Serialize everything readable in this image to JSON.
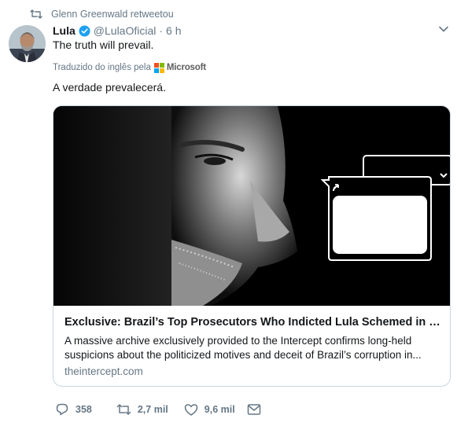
{
  "retweet": {
    "text": "Glenn Greenwald retweetou"
  },
  "tweet": {
    "display_name": "Lula",
    "handle": "@LulaOficial",
    "separator": "·",
    "time": "6 h",
    "text": "The truth will prevail.",
    "translation_label": "Traduzido do inglês pela",
    "translation_provider": "Microsoft",
    "translated_text": "A verdade prevalecerá."
  },
  "card": {
    "title": "Exclusive: Brazil’s Top Prosecutors Who Indicted Lula Schemed in S...",
    "description_line1": "A massive archive exclusively provided to the Intercept confirms long-held",
    "description_line2": "suspicions about the politicized motives and deceit of Brazil’s corruption in...",
    "domain": "theintercept.com"
  },
  "actions": {
    "replies": "358",
    "retweets": "2,7 mil",
    "likes": "9,6 mil"
  },
  "colors": {
    "muted": "#657786",
    "verified": "#1da1f2",
    "border": "#ccd6dd",
    "ms_red": "#f25022",
    "ms_green": "#7fba00",
    "ms_blue": "#00a4ef",
    "ms_yellow": "#ffb900"
  },
  "icons": [
    "retweet-icon",
    "verified-badge-icon",
    "chevron-down-icon",
    "microsoft-logo",
    "reply-icon",
    "like-icon",
    "direct-message-icon"
  ]
}
